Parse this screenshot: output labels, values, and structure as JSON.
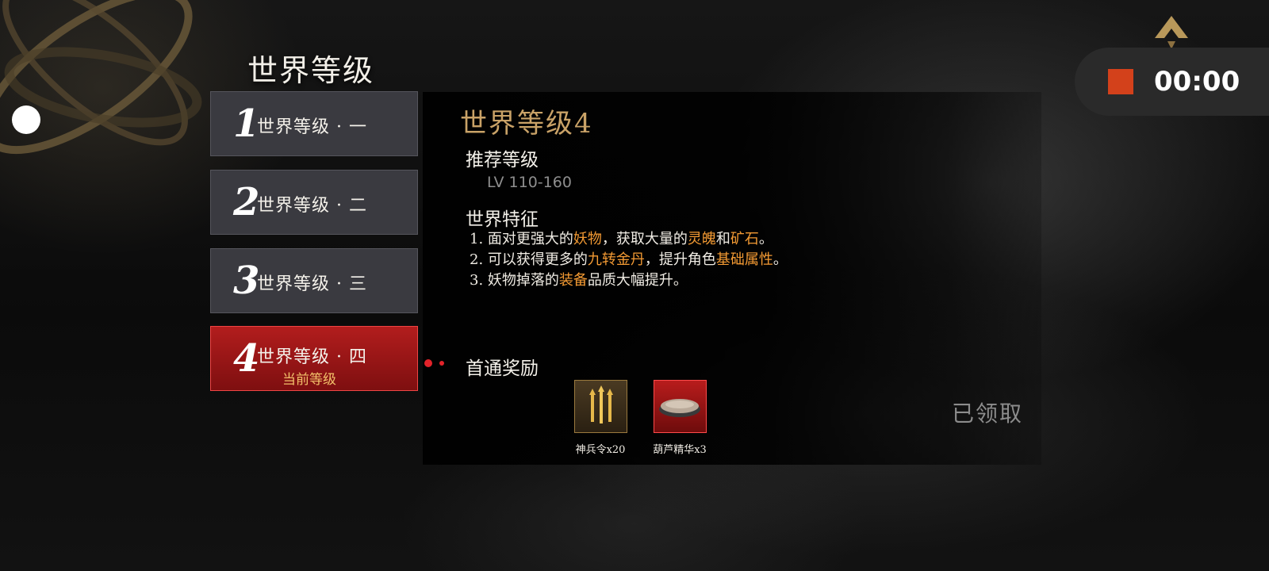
{
  "header": {
    "title": "世界等级"
  },
  "recorder": {
    "time": "00:00"
  },
  "tabs": [
    {
      "num": "1",
      "label": "世界等级 · 一"
    },
    {
      "num": "2",
      "label": "世界等级 · 二"
    },
    {
      "num": "3",
      "label": "世界等级 · 三"
    },
    {
      "num": "4",
      "label": "世界等级 · 四",
      "sub": "当前等级"
    }
  ],
  "detail": {
    "title": "世界等级4",
    "recommend_label": "推荐等级",
    "recommend_value": "LV 110-160",
    "feature_label": "世界特征",
    "features": [
      {
        "n": "1. ",
        "p1": "面对更强大的",
        "h1": "妖物",
        "p2": "，获取大量的",
        "h2": "灵魄",
        "p3": "和",
        "h3": "矿石",
        "p4": "。"
      },
      {
        "n": "2. ",
        "p1": "可以获得更多的",
        "h1": "九转金丹",
        "p2": "，提升角色",
        "h2": "基础属性",
        "p3": "。"
      },
      {
        "n": "3. ",
        "p1": "妖物掉落的",
        "h1": "装备",
        "p2": "品质大幅提升。"
      }
    ],
    "reward_label": "首通奖励",
    "rewards": [
      {
        "name": "神兵令x20",
        "icon": "golden-spears-icon"
      },
      {
        "name": "葫芦精华x3",
        "icon": "powder-bowl-icon"
      }
    ],
    "claimed": "已领取"
  },
  "colors": {
    "highlight": "#f39a33",
    "gold_title": "#c9a267",
    "active_tab": "#b21d1d",
    "record": "#d3411b"
  }
}
